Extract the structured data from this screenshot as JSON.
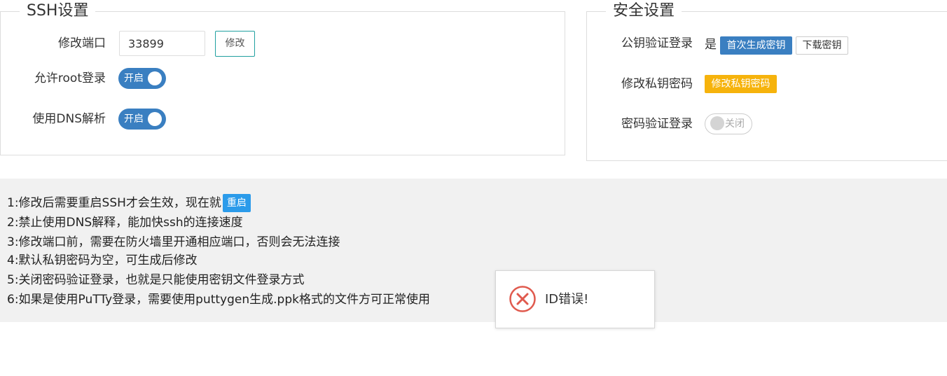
{
  "ssh": {
    "legend": "SSH设置",
    "port_label": "修改端口",
    "port_value": "33899",
    "edit_button": "修改",
    "root_label": "允许root登录",
    "root_toggle": "开启",
    "dns_label": "使用DNS解析",
    "dns_toggle": "开启"
  },
  "security": {
    "legend": "安全设置",
    "pubkey_label": "公钥验证登录",
    "pubkey_value": "是",
    "gen_key_button": "首次生成密钥",
    "download_key_button": "下载密钥",
    "privkey_label": "修改私钥密码",
    "privkey_button": "修改私钥密码",
    "password_label": "密码验证登录",
    "password_toggle": "关闭"
  },
  "notes": {
    "line1": "1:修改后需要重启SSH才会生效，现在就",
    "restart_button": "重启",
    "line2": "2:禁止使用DNS解释，能加快ssh的连接速度",
    "line3": "3:修改端口前，需要在防火墙里开通相应端口，否则会无法连接",
    "line4": "4:默认私钥密码为空，可生成后修改",
    "line5": "5:关闭密码验证登录，也就是只能使用密钥文件登录方式",
    "line6": "6:如果是使用PuTTy登录，需要使用puttygen生成.ppk格式的文件方可正常使用"
  },
  "toast": {
    "icon": "error-circle-icon",
    "message": "ID错误!"
  },
  "colors": {
    "toggle_on": "#3a7fc1",
    "primary": "#3a7fc1",
    "warn": "#f6b30c",
    "restart": "#2b9bea",
    "error": "#e05a4e",
    "notes_bg": "#f1f1f1"
  }
}
